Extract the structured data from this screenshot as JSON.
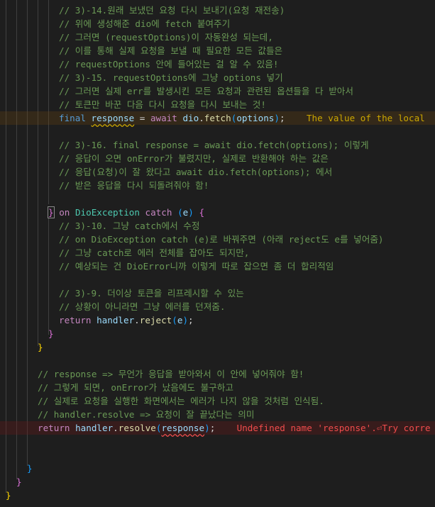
{
  "code": {
    "comments": [
      "// 3)-14.원래 보냈던 요청 다시 보내기(요청 재전송)",
      "// 위에 생성해준 dio에 fetch 붙여주기",
      "// 그러면 (requestOptions)이 자동완성 되는데,",
      "// 이를 통해 실제 요청을 보낼 때 필요한 모든 값들은",
      "// requestOptions 안에 들어있는 걸 알 수 있음!",
      "// 3)-15. requestOptions에 그냥 options 넣기",
      "// 그러면 실제 err를 발생시킨 모든 요청과 관련된 옵션들을 다 받아서",
      "// 토큰만 바꾼 다음 다시 요청을 다시 보내는 것!",
      "// 3)-16. final response = await dio.fetch(options); 이렇게",
      "// 응답이 오면 onError가 불렸지만, 실제로 반환해야 하는 값은",
      "// 응답(요청)이 잘 왔다고 await dio.fetch(options); 에서",
      "// 받은 응답을 다시 되돌려줘야 함!",
      "// 3)-10. 그냥 catch에서 수정",
      "// on DioException catch (e)로 바꿔주면 (아래 reject도 e를 넣어줌)",
      "// 그냥 catch로 에러 전체를 잡아도 되지만,",
      "// 예상되는 건 DioError니까 이렇게 따로 잡으면 좀 더 합리적임",
      "// 3)-9. 더이상 토큰을 리프레시할 수 있는",
      "// 상황이 아니라면 그냥 에러를 던져줌.",
      "// response => 무언가 응답을 받아와서 이 안에 넣어줘야 함!",
      "// 그렇게 되면, onError가 났음에도 불구하고",
      "// 실제로 요청을 실행한 화면에서는 에러가 나지 않을 것처럼 인식됨.",
      "// handler.resolve => 요청이 잘 끝났다는 의미"
    ],
    "fetch_line": {
      "kw_final": "final",
      "var_response": "response",
      "op_eq": " = ",
      "kw_await": "await",
      "obj_dio": "dio",
      "fn_fetch": "fetch",
      "arg_options": "options",
      "end": ");",
      "diagnostic": "The value of the local"
    },
    "catch_line": {
      "close_brace": "}",
      "kw_on": "on",
      "type_name": "DioException",
      "kw_catch": "catch",
      "param": "e",
      "open_brace": "{"
    },
    "reject_line": {
      "kw_return": "return",
      "obj": "handler",
      "fn": "reject",
      "arg": "e",
      "end": ");"
    },
    "resolve_line": {
      "kw_return": "return",
      "obj": "handler",
      "fn": "resolve",
      "arg": "response",
      "end": ");",
      "diagnostic": "Undefined name 'response'.⏎Try corre"
    },
    "braces": {
      "close": "}"
    }
  }
}
